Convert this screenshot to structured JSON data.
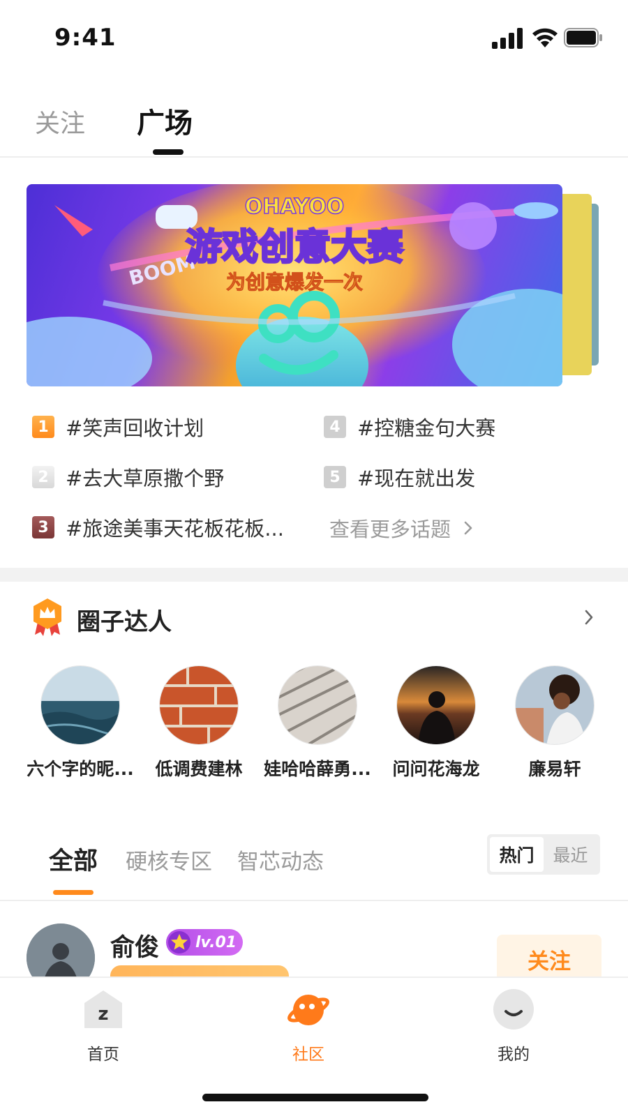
{
  "status_bar": {
    "time": "9:41"
  },
  "top_tabs": [
    {
      "label": "关注"
    },
    {
      "label": "广场"
    }
  ],
  "banner": {
    "brand": "OHAYOO",
    "title": "游戏创意大赛",
    "subtitle": "为创意爆发一次",
    "sticker": "BOOM"
  },
  "topics": [
    {
      "rank": "1",
      "text": "#笑声回收计划"
    },
    {
      "rank": "2",
      "text": "#去大草原撒个野"
    },
    {
      "rank": "3",
      "text": "#旅途美事天花板花板..."
    },
    {
      "rank": "4",
      "text": "#控糖金句大赛"
    },
    {
      "rank": "5",
      "text": "#现在就出发"
    }
  ],
  "more_topics": "查看更多话题",
  "experts": {
    "title": "圈子达人",
    "items": [
      {
        "name": "六个字的昵..."
      },
      {
        "name": "低调费建林"
      },
      {
        "name": "娃哈哈薛勇..."
      },
      {
        "name": "问问花海龙"
      },
      {
        "name": "廉易轩"
      }
    ]
  },
  "categories": [
    {
      "label": "全部"
    },
    {
      "label": "硬核专区"
    },
    {
      "label": "智芯动态"
    }
  ],
  "sort": {
    "hot": "热门",
    "recent": "最近"
  },
  "post": {
    "author": "俞俊",
    "level": "lv.01",
    "follow_label": "关注"
  },
  "tabbar": [
    {
      "label": "首页"
    },
    {
      "label": "社区"
    },
    {
      "label": "我的"
    }
  ],
  "colors": {
    "accent": "#ff8a1c",
    "level_badge": "#b34ee8"
  }
}
